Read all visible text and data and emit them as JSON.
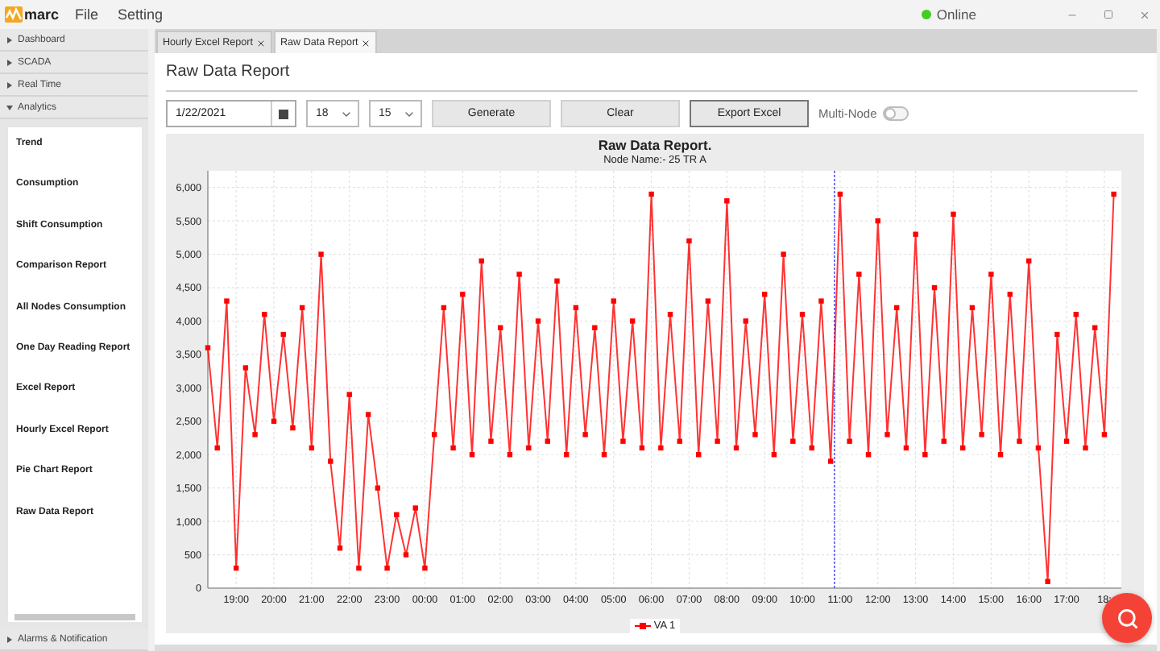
{
  "app": {
    "logo": "marc",
    "menu": [
      "File",
      "Setting"
    ],
    "status": {
      "label": "Online",
      "online": true
    }
  },
  "sidebar": {
    "sections": [
      {
        "label": "Dashboard",
        "expanded": false
      },
      {
        "label": "SCADA",
        "expanded": false
      },
      {
        "label": "Real Time",
        "expanded": false
      },
      {
        "label": "Analytics",
        "expanded": true,
        "items": [
          "Trend",
          "Consumption",
          "Shift Consumption",
          "Comparison Report",
          "All Nodes Consumption",
          "One Day Reading Report",
          "Excel Report",
          "Hourly Excel Report",
          "Pie Chart Report",
          "Raw Data Report"
        ]
      },
      {
        "label": "Alarms & Notification",
        "expanded": false
      }
    ]
  },
  "tabs": [
    {
      "label": "Hourly Excel Report",
      "selected": false
    },
    {
      "label": "Raw Data Report",
      "selected": true
    }
  ],
  "page": {
    "title": "Raw Data Report",
    "date": "1/22/2021",
    "hour": "18",
    "minute": "15",
    "buttons": [
      {
        "label": "Generate",
        "focused": false
      },
      {
        "label": "Clear",
        "focused": false
      },
      {
        "label": "Export Excel",
        "focused": true
      }
    ],
    "multi_node": {
      "label": "Multi-Node",
      "on": false
    }
  },
  "chart": {
    "title": "Raw Data Report.",
    "subtitle": "Node Name:- 25 TR A",
    "chart_data": {
      "type": "line",
      "x": [
        "2021-01-22T18:15",
        "2021-01-22T18:30",
        "2021-01-22T18:45",
        "2021-01-22T19:00",
        "2021-01-22T19:15",
        "2021-01-22T19:30",
        "2021-01-22T19:45",
        "2021-01-22T20:00",
        "2021-01-22T20:15",
        "2021-01-22T20:30",
        "2021-01-22T20:45",
        "2021-01-22T21:00",
        "2021-01-22T21:15",
        "2021-01-22T21:30",
        "2021-01-22T21:45",
        "2021-01-22T22:00",
        "2021-01-22T22:15",
        "2021-01-22T22:30",
        "2021-01-22T22:45",
        "2021-01-22T23:00",
        "2021-01-22T23:15",
        "2021-01-22T23:30",
        "2021-01-22T23:45",
        "2021-01-23T00:00",
        "2021-01-23T00:15",
        "2021-01-23T00:30",
        "2021-01-23T00:45",
        "2021-01-23T01:00",
        "2021-01-23T01:15",
        "2021-01-23T01:30",
        "2021-01-23T01:45",
        "2021-01-23T02:00",
        "2021-01-23T02:15",
        "2021-01-23T02:30",
        "2021-01-23T02:45",
        "2021-01-23T03:00",
        "2021-01-23T03:15",
        "2021-01-23T03:30",
        "2021-01-23T03:45",
        "2021-01-23T04:00",
        "2021-01-23T04:15",
        "2021-01-23T04:30",
        "2021-01-23T04:45",
        "2021-01-23T05:00",
        "2021-01-23T05:15",
        "2021-01-23T05:30",
        "2021-01-23T05:45",
        "2021-01-23T06:00",
        "2021-01-23T06:15",
        "2021-01-23T06:30",
        "2021-01-23T06:45",
        "2021-01-23T07:00",
        "2021-01-23T07:15",
        "2021-01-23T07:30",
        "2021-01-23T07:45",
        "2021-01-23T08:00",
        "2021-01-23T08:15",
        "2021-01-23T08:30",
        "2021-01-23T08:45",
        "2021-01-23T09:00",
        "2021-01-23T09:15",
        "2021-01-23T09:30",
        "2021-01-23T09:45",
        "2021-01-23T10:00",
        "2021-01-23T10:15",
        "2021-01-23T10:30",
        "2021-01-23T10:45",
        "2021-01-23T11:00",
        "2021-01-23T11:15",
        "2021-01-23T11:30",
        "2021-01-23T11:45",
        "2021-01-23T12:00",
        "2021-01-23T12:15",
        "2021-01-23T12:30",
        "2021-01-23T12:45",
        "2021-01-23T13:00",
        "2021-01-23T13:15",
        "2021-01-23T13:30",
        "2021-01-23T13:45",
        "2021-01-23T14:00",
        "2021-01-23T14:15",
        "2021-01-23T14:30",
        "2021-01-23T14:45",
        "2021-01-23T15:00",
        "2021-01-23T15:15",
        "2021-01-23T15:30",
        "2021-01-23T15:45",
        "2021-01-23T16:00",
        "2021-01-23T16:15",
        "2021-01-23T16:30",
        "2021-01-23T16:45",
        "2021-01-23T17:00",
        "2021-01-23T17:15",
        "2021-01-23T17:30",
        "2021-01-23T17:45",
        "2021-01-23T18:00",
        "2021-01-23T18:15"
      ],
      "series": [
        {
          "name": "VA 1",
          "color": "#ff0000",
          "marker": "square",
          "values": [
            3600,
            2100,
            4300,
            300,
            3300,
            2300,
            4100,
            2500,
            3800,
            2400,
            4200,
            2100,
            5000,
            1900,
            600,
            2900,
            300,
            2600,
            1500,
            300,
            1100,
            500,
            1200,
            300,
            2300,
            4200,
            2100,
            4400,
            2000,
            4900,
            2200,
            3900,
            2000,
            4700,
            2100,
            4000,
            2200,
            4600,
            2000,
            4200,
            2300,
            3900,
            2000,
            4300,
            2200,
            4000,
            2100,
            5900,
            2100,
            4100,
            2200,
            5200,
            2000,
            4300,
            2200,
            5800,
            2100,
            4000,
            2300,
            4400,
            2000,
            5000,
            2200,
            4100,
            2100,
            4300,
            1900,
            5900,
            2200,
            4700,
            2000,
            5500,
            2300,
            4200,
            2100,
            5300,
            2000,
            4500,
            2200,
            5600,
            2100,
            4200,
            2300,
            4700,
            2000,
            4400,
            2200,
            4900,
            2100,
            100,
            3800,
            2200,
            4100,
            2100,
            3900,
            2300,
            5900
          ]
        }
      ],
      "xlim": [
        "2021-01-22T18:15",
        "2021-01-23T18:27"
      ],
      "ylim": [
        0,
        6250
      ],
      "grid": true,
      "xticks": [
        {
          "value": "2021-01-22T19:00",
          "label": "19:00"
        },
        {
          "value": "2021-01-22T20:00",
          "label": "20:00"
        },
        {
          "value": "2021-01-22T21:00",
          "label": "21:00"
        },
        {
          "value": "2021-01-22T22:00",
          "label": "22:00"
        },
        {
          "value": "2021-01-22T23:00",
          "label": "23:00"
        },
        {
          "value": "2021-01-23T00:00",
          "label": "00:00"
        },
        {
          "value": "2021-01-23T01:00",
          "label": "01:00"
        },
        {
          "value": "2021-01-23T02:00",
          "label": "02:00"
        },
        {
          "value": "2021-01-23T03:00",
          "label": "03:00"
        },
        {
          "value": "2021-01-23T04:00",
          "label": "04:00"
        },
        {
          "value": "2021-01-23T05:00",
          "label": "05:00"
        },
        {
          "value": "2021-01-23T06:00",
          "label": "06:00"
        },
        {
          "value": "2021-01-23T07:00",
          "label": "07:00"
        },
        {
          "value": "2021-01-23T08:00",
          "label": "08:00"
        },
        {
          "value": "2021-01-23T09:00",
          "label": "09:00"
        },
        {
          "value": "2021-01-23T10:00",
          "label": "10:00"
        },
        {
          "value": "2021-01-23T11:00",
          "label": "11:00"
        },
        {
          "value": "2021-01-23T12:00",
          "label": "12:00"
        },
        {
          "value": "2021-01-23T13:00",
          "label": "13:00"
        },
        {
          "value": "2021-01-23T14:00",
          "label": "14:00"
        },
        {
          "value": "2021-01-23T15:00",
          "label": "15:00"
        },
        {
          "value": "2021-01-23T16:00",
          "label": "16:00"
        },
        {
          "value": "2021-01-23T17:00",
          "label": "17:00"
        },
        {
          "value": "2021-01-23T18:00",
          "label": "18:"
        }
      ],
      "yticks": [
        {
          "value": 0,
          "label": "0"
        },
        {
          "value": 500,
          "label": "500"
        },
        {
          "value": 1000,
          "label": "1,000"
        },
        {
          "value": 1500,
          "label": "1,500"
        },
        {
          "value": 2000,
          "label": "2,000"
        },
        {
          "value": 2500,
          "label": "2,500"
        },
        {
          "value": 3000,
          "label": "3,000"
        },
        {
          "value": 3500,
          "label": "3,500"
        },
        {
          "value": 4000,
          "label": "4,000"
        },
        {
          "value": 4500,
          "label": "4,500"
        },
        {
          "value": 5000,
          "label": "5,000"
        },
        {
          "value": 5500,
          "label": "5,500"
        },
        {
          "value": 6000,
          "label": "6,000"
        }
      ],
      "ref_lines": [
        {
          "axis": "x",
          "value": "2021-01-23T10:51",
          "color": "#5555ff"
        }
      ]
    }
  }
}
